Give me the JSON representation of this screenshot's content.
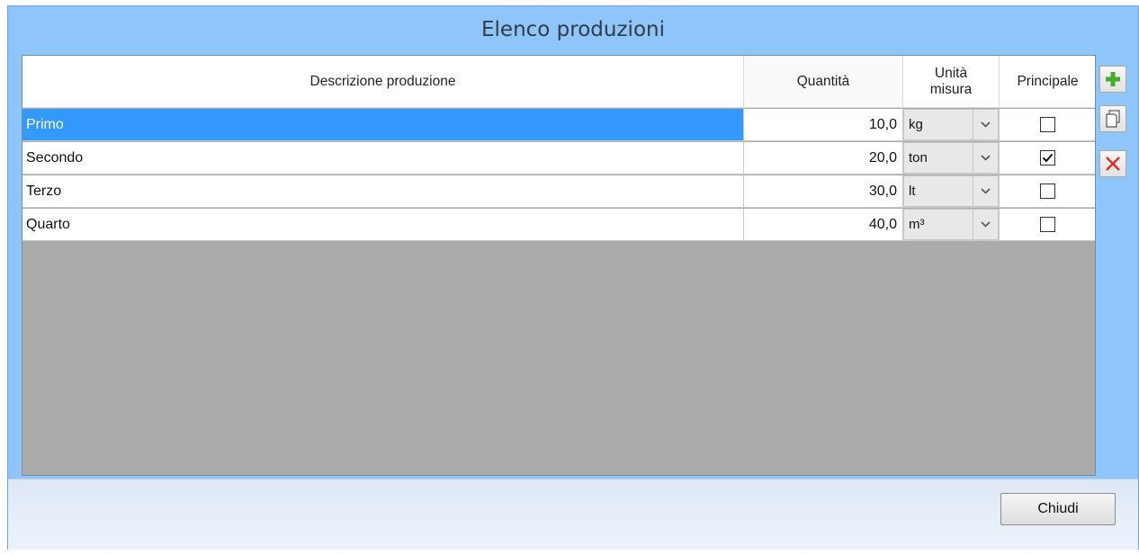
{
  "window": {
    "title": "Elenco produzioni"
  },
  "table": {
    "columns": {
      "description": "Descrizione produzione",
      "quantity": "Quantità",
      "unit_line1": "Unità",
      "unit_line2": "misura",
      "main": "Principale"
    },
    "rows": [
      {
        "description": "Primo",
        "quantity": "10,0",
        "unit": "kg",
        "main": false,
        "selected": true
      },
      {
        "description": "Secondo",
        "quantity": "20,0",
        "unit": "ton",
        "main": true,
        "selected": false
      },
      {
        "description": "Terzo",
        "quantity": "30,0",
        "unit": "lt",
        "main": false,
        "selected": false
      },
      {
        "description": "Quarto",
        "quantity": "40,0",
        "unit": "m³",
        "main": false,
        "selected": false
      }
    ]
  },
  "toolbar": {
    "add_icon": "plus-icon",
    "copy_icon": "copy-icon",
    "delete_icon": "delete-icon"
  },
  "footer": {
    "close_label": "Chiudi"
  },
  "colors": {
    "window_bg": "#8ec5fb",
    "selection": "#3399ff",
    "grid_empty": "#ababab",
    "add_green": "#3fae2a",
    "delete_red": "#e0312a"
  }
}
